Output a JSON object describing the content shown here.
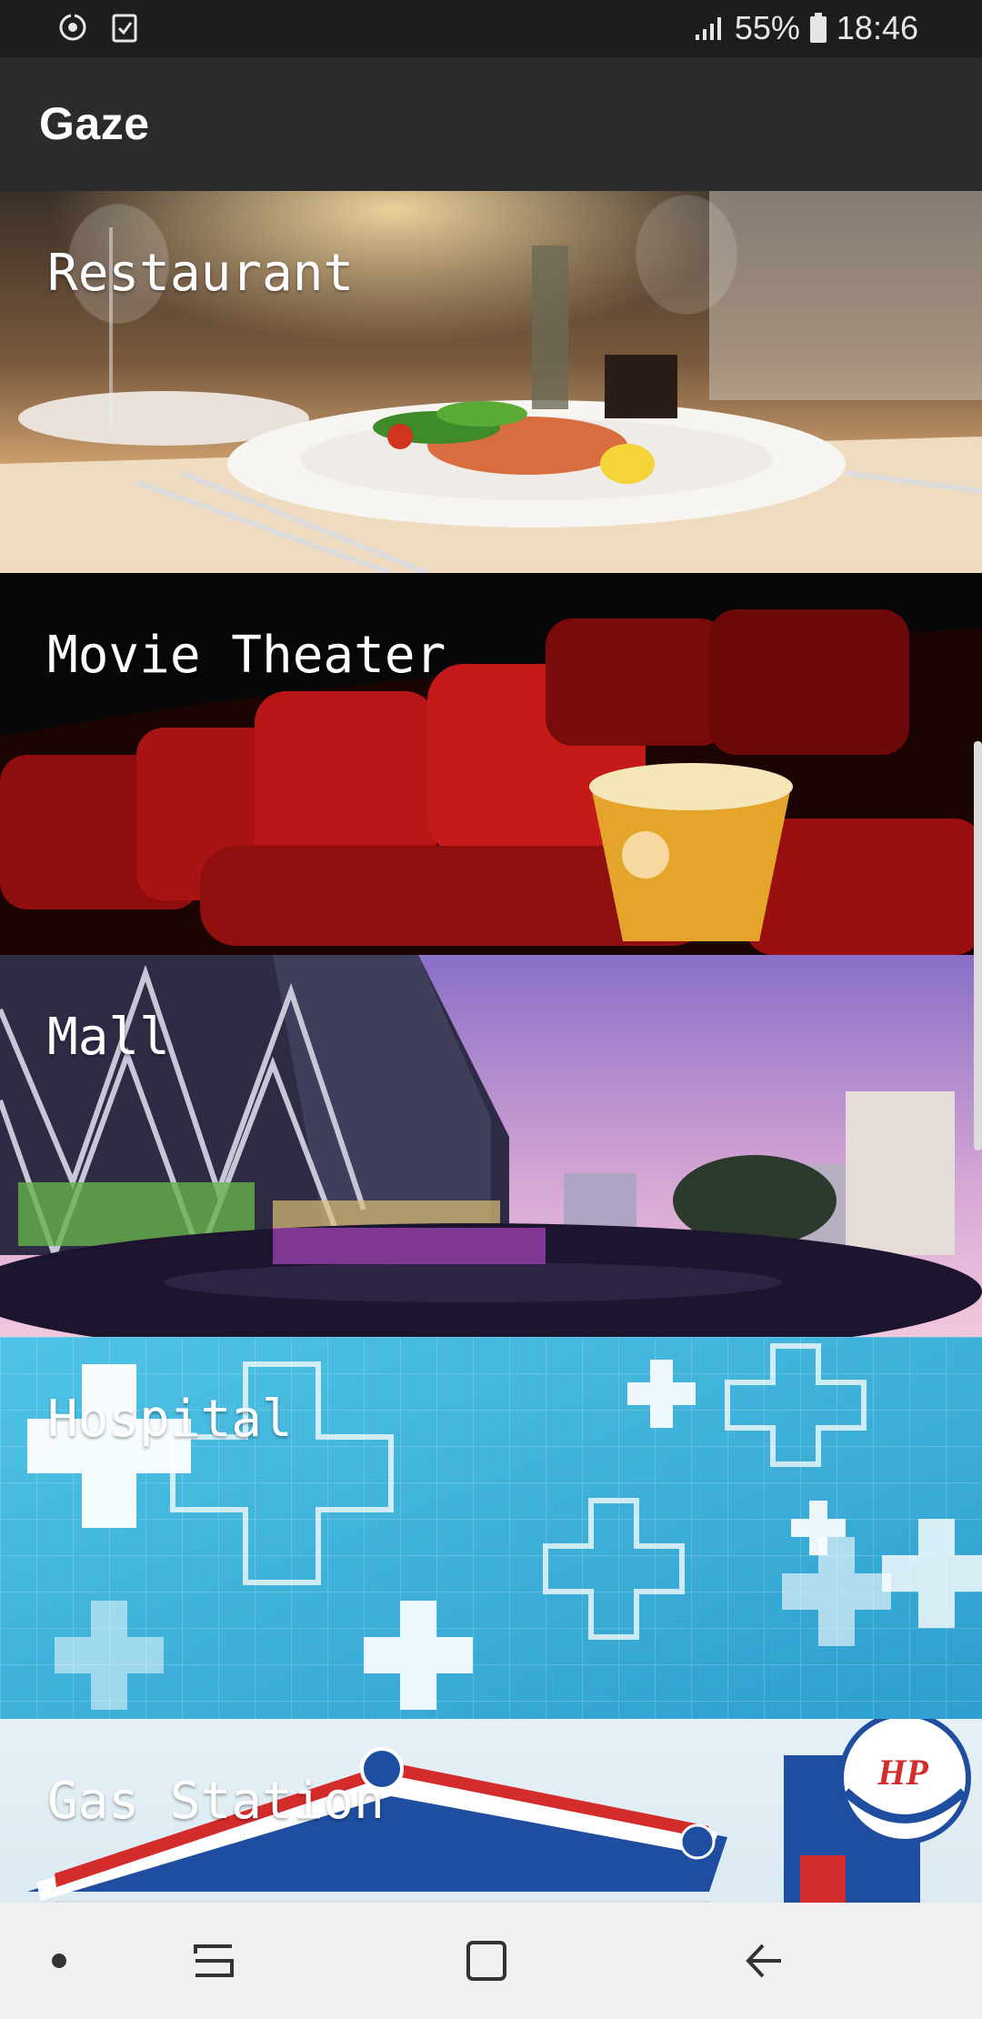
{
  "status_bar": {
    "battery": "55%",
    "time": "18:46",
    "icons": [
      "sync-icon",
      "clipboard-check-icon",
      "signal-icon",
      "battery-icon"
    ]
  },
  "app_bar": {
    "title": "Gaze"
  },
  "categories": [
    {
      "label": "Restaurant",
      "image": "restaurant-image"
    },
    {
      "label": "Movie Theater",
      "image": "movie-theater-image"
    },
    {
      "label": "Mall",
      "image": "mall-image"
    },
    {
      "label": "Hospital",
      "image": "hospital-image"
    },
    {
      "label": "Gas Station",
      "image": "gas-station-image"
    }
  ],
  "gas_station_sign": "HP",
  "nav_bar": {
    "icons": [
      "dot-icon",
      "recent-apps-icon",
      "home-icon",
      "back-icon"
    ]
  }
}
